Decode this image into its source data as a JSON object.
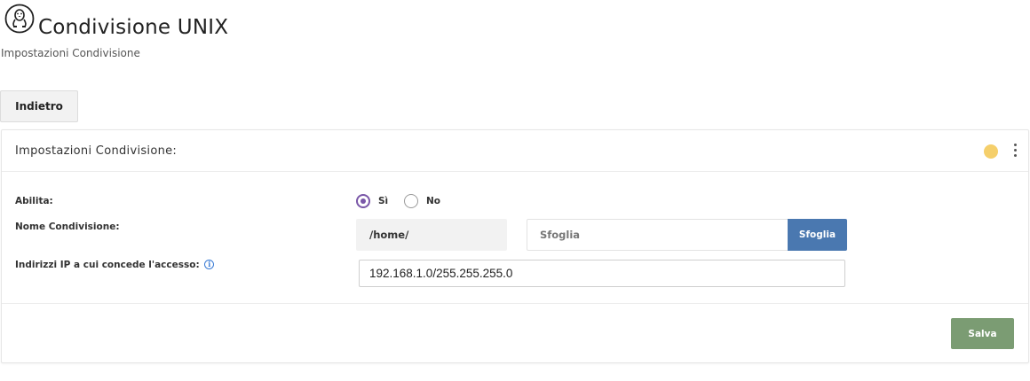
{
  "header": {
    "logo_icon": "tux-linux-icon",
    "title": "Condivisione UNIX",
    "subtitle": "Impostazioni Condivisione"
  },
  "toolbar": {
    "back_label": "Indietro"
  },
  "panel": {
    "title": "Impostazioni Condivisione:",
    "status_color": "#f5cf6b",
    "menu_icon": "kebab-menu-icon",
    "fields": {
      "enable": {
        "label": "Abilita:",
        "options": [
          "Sì",
          "No"
        ],
        "selected": "Sì"
      },
      "share_name": {
        "label": "Nome Condivisione:",
        "prefix": "/home/",
        "value": "",
        "placeholder": "Sfoglia",
        "browse_label": "Sfoglia"
      },
      "ip_access": {
        "label": "Indirizzi IP a cui concede l'accesso:",
        "info_icon": "info-icon",
        "value": "192.168.1.0/255.255.255.0"
      }
    },
    "save_label": "Salva"
  },
  "colors": {
    "accent_radio": "#7a57a8",
    "browse_button": "#4a78b0",
    "save_button": "#7b9c73",
    "status_dot": "#f5cf6b"
  }
}
